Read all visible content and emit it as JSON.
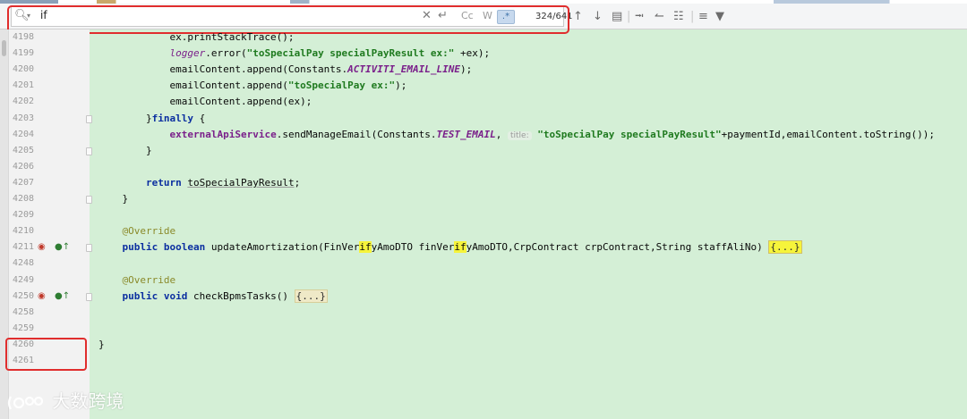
{
  "search": {
    "query": "if",
    "match_count": "324/641",
    "case_toggle": "Cc",
    "words_toggle": "W",
    "regex_toggle": ".*"
  },
  "icons": {
    "search": "search-icon",
    "clear": "close-icon",
    "replace": "replace-icon",
    "prev": "arrow-up-icon",
    "next": "arrow-down-icon",
    "filter": "filter-icon"
  },
  "colors": {
    "highlight_border": "#e02d2d",
    "editor_bg": "#d4efd6",
    "match_highlight": "#f6f43b"
  },
  "lines": [
    {
      "num": "4198",
      "segments": [
        {
          "t": "            ex.printStackTrace();"
        }
      ]
    },
    {
      "num": "4199",
      "segments": [
        {
          "t": "            "
        },
        {
          "t": "logger",
          "c": "logger"
        },
        {
          "t": ".error("
        },
        {
          "t": "\"toSpecialPay specialPayResult ex:\"",
          "c": "str"
        },
        {
          "t": " +ex);"
        }
      ]
    },
    {
      "num": "4200",
      "segments": [
        {
          "t": "            emailContent.append(Constants."
        },
        {
          "t": "ACTIVITI_EMAIL_LINE",
          "c": "const"
        },
        {
          "t": ");"
        }
      ]
    },
    {
      "num": "4201",
      "segments": [
        {
          "t": "            emailContent.append("
        },
        {
          "t": "\"toSpecialPay ex:\"",
          "c": "str"
        },
        {
          "t": ");"
        }
      ]
    },
    {
      "num": "4202",
      "segments": [
        {
          "t": "            emailContent.append(ex);"
        }
      ]
    },
    {
      "num": "4203",
      "segments": [
        {
          "t": "        }"
        },
        {
          "t": "finally",
          "c": "kw"
        },
        {
          "t": " {"
        }
      ]
    },
    {
      "num": "4204",
      "segments": [
        {
          "t": "            "
        },
        {
          "t": "externalApiService",
          "c": "field"
        },
        {
          "t": ".sendManageEmail(Constants."
        },
        {
          "t": "TEST_EMAIL",
          "c": "const"
        },
        {
          "t": ", "
        },
        {
          "t": "title:",
          "c": "hint"
        },
        {
          "t": " "
        },
        {
          "t": "\"toSpecialPay specialPayResult\"",
          "c": "str"
        },
        {
          "t": "+paymentId,emailContent.toString());"
        }
      ]
    },
    {
      "num": "4205",
      "segments": [
        {
          "t": "        }"
        }
      ]
    },
    {
      "num": "4206",
      "segments": [
        {
          "t": ""
        }
      ]
    },
    {
      "num": "4207",
      "segments": [
        {
          "t": "        "
        },
        {
          "t": "return",
          "c": "kw"
        },
        {
          "t": " "
        },
        {
          "t": "toSpecialPayResult",
          "c": "underline"
        },
        {
          "t": ";"
        }
      ]
    },
    {
      "num": "4208",
      "segments": [
        {
          "t": "    }"
        }
      ]
    },
    {
      "num": "4209",
      "segments": [
        {
          "t": ""
        }
      ]
    },
    {
      "num": "4210",
      "segments": [
        {
          "t": "    "
        },
        {
          "t": "@Override",
          "c": "ann"
        }
      ]
    },
    {
      "num": "4211",
      "segments": [
        {
          "t": "    "
        },
        {
          "t": "public",
          "c": "kw"
        },
        {
          "t": " "
        },
        {
          "t": "boolean",
          "c": "kw"
        },
        {
          "t": " updateAmortization(FinVer"
        },
        {
          "t": "if",
          "c": "hl"
        },
        {
          "t": "yAmoDTO finVer"
        },
        {
          "t": "if",
          "c": "hl"
        },
        {
          "t": "yAmoDTO,CrpContract crpContract,String staffAliNo) "
        },
        {
          "t": "{...}",
          "c": "fold-sel"
        }
      ]
    },
    {
      "num": "4248",
      "segments": [
        {
          "t": ""
        }
      ]
    },
    {
      "num": "4249",
      "segments": [
        {
          "t": "    "
        },
        {
          "t": "@Override",
          "c": "ann"
        }
      ]
    },
    {
      "num": "4250",
      "segments": [
        {
          "t": "    "
        },
        {
          "t": "public",
          "c": "kw"
        },
        {
          "t": " "
        },
        {
          "t": "void",
          "c": "kw"
        },
        {
          "t": " checkBpmsTasks() "
        },
        {
          "t": "{...}",
          "c": "fold"
        }
      ]
    },
    {
      "num": "4258",
      "segments": [
        {
          "t": ""
        }
      ]
    },
    {
      "num": "4259",
      "segments": [
        {
          "t": ""
        }
      ]
    },
    {
      "num": "4260",
      "segments": [
        {
          "t": "}"
        }
      ]
    },
    {
      "num": "4261",
      "segments": [
        {
          "t": ""
        }
      ]
    }
  ],
  "watermark": {
    "text": "大数跨境"
  }
}
